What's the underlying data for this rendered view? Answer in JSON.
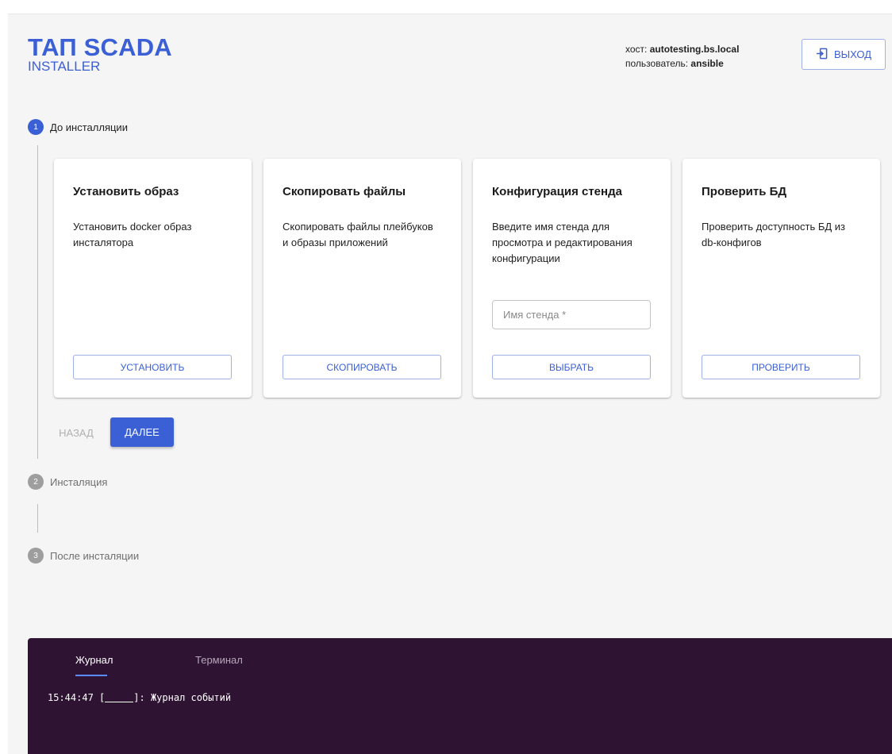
{
  "header": {
    "title": "ТАП SCADA",
    "subtitle": "INSTALLER",
    "host_label": "хост:",
    "host_value": "autotesting.bs.local",
    "user_label": "пользователь:",
    "user_value": "ansible",
    "logout_label": "ВЫХОД",
    "logout_icon": "logout-icon"
  },
  "stepper": {
    "steps": [
      {
        "number": "1",
        "label": "До инсталляции",
        "state": "active"
      },
      {
        "number": "2",
        "label": "Инсталяция",
        "state": "inactive"
      },
      {
        "number": "3",
        "label": "После инсталяции",
        "state": "inactive"
      }
    ],
    "back_label": "НАЗАД",
    "next_label": "ДАЛЕЕ"
  },
  "cards": [
    {
      "title": "Установить образ",
      "description": "Установить docker образ инсталятора",
      "button": "УСТАНОВИТЬ"
    },
    {
      "title": "Скопировать файлы",
      "description": "Скопировать файлы плейбуков и образы приложений",
      "button": "СКОПИРОВАТЬ"
    },
    {
      "title": "Конфигурация стенда",
      "description": "Введите имя стенда для просмотра и редактирования конфигурации",
      "input_placeholder": "Имя стенда *",
      "input_value": "",
      "button": "ВЫБРАТЬ"
    },
    {
      "title": "Проверить БД",
      "description": "Проверить доступность БД из db-конфигов",
      "button": "ПРОВЕРИТЬ"
    }
  ],
  "console": {
    "tabs": [
      {
        "label": "Журнал",
        "active": true
      },
      {
        "label": "Терминал",
        "active": false
      }
    ],
    "log": [
      {
        "time": "15:44:47",
        "tag_open": "[",
        "tag_close": "]:",
        "message": "Журнал событий"
      }
    ]
  },
  "colors": {
    "accent": "#3b5fd4",
    "console_bg": "#2e1432",
    "page_bg": "#f5f5f5"
  }
}
